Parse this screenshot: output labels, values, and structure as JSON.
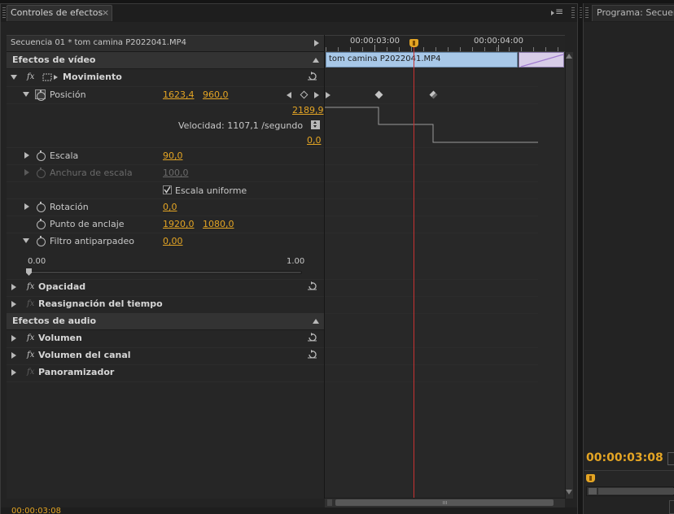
{
  "panel": {
    "title": "Controles de efectos",
    "close": "×",
    "menu_icon": "≡",
    "right_panel_title": "Programa: Secuenc"
  },
  "sequence": {
    "label": "Secuencia 01 * tom camina P2022041.MP4"
  },
  "timeline": {
    "ruler_time_1": "00:00:03:00",
    "ruler_time_2": "00:00:04:00",
    "clip_name": "tom camina P2022041.MP4"
  },
  "video_effects": {
    "header": "Efectos de vídeo",
    "movimiento": {
      "name": "Movimiento",
      "posicion": {
        "label": "Posición",
        "x": "1623,4",
        "y": "960,0",
        "graph_max": "2189,9",
        "velocity": "Velocidad: 1107,1 /segundo",
        "graph_min": "0,0"
      },
      "escala": {
        "label": "Escala",
        "value": "90,0"
      },
      "anchura": {
        "label": "Anchura de escala",
        "value": "100,0"
      },
      "uniforme": {
        "label": "Escala uniforme",
        "checked": true
      },
      "rotacion": {
        "label": "Rotación",
        "value": "0,0"
      },
      "anclaje": {
        "label": "Punto de anclaje",
        "x": "1920,0",
        "y": "1080,0"
      },
      "antiparpadeo": {
        "label": "Filtro antiparpadeo",
        "value": "0,00",
        "slider_min": "0.00",
        "slider_max": "1.00"
      }
    },
    "opacidad": "Opacidad",
    "reasignacion": "Reasignación del tiempo"
  },
  "audio_effects": {
    "header": "Efectos de audio",
    "volumen": "Volumen",
    "volumen_canal": "Volumen del canal",
    "panoramizador": "Panoramizador"
  },
  "program": {
    "timecode": "00:00:03:08"
  },
  "bottom": {
    "timecode": "00:00:03:08"
  },
  "colors": {
    "accent_orange": "#e4a524",
    "clip_blue": "#a8c8e8",
    "playhead_red": "#c83232"
  }
}
